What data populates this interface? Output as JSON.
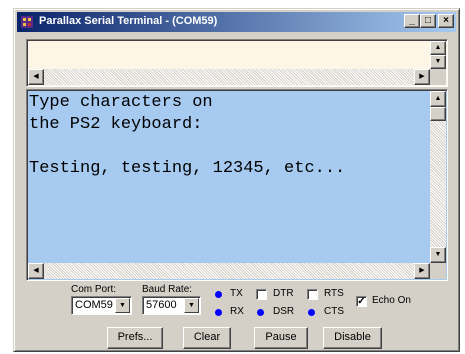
{
  "window": {
    "title": "Parallax Serial Terminal - (COM59)",
    "controls": {
      "minimize": "_",
      "maximize": "□",
      "close": "×"
    }
  },
  "transmit": {
    "text": ""
  },
  "receive": {
    "lines": [
      "Type characters on",
      "the PS2 keyboard:",
      "",
      "Testing, testing, 12345, etc..."
    ]
  },
  "settings": {
    "com_port_label": "Com Port:",
    "com_port_value": "COM59",
    "baud_rate_label": "Baud Rate:",
    "baud_rate_value": "57600"
  },
  "indicators": {
    "tx": {
      "label": "TX",
      "color": "#0000ff"
    },
    "rx": {
      "label": "RX",
      "color": "#0000ff"
    },
    "dsr": {
      "label": "DSR",
      "color": "#0000ff"
    },
    "cts": {
      "label": "CTS",
      "color": "#0000ff"
    }
  },
  "checkboxes": {
    "dtr": {
      "label": "DTR",
      "checked": false
    },
    "rts": {
      "label": "RTS",
      "checked": false
    },
    "echo": {
      "label": "Echo On",
      "checked": true,
      "mark": "✓"
    }
  },
  "buttons": {
    "prefs": "Prefs...",
    "clear": "Clear",
    "pause": "Pause",
    "disable": "Disable"
  },
  "colors": {
    "titlebar_start": "#0a246a",
    "titlebar_end": "#a6caf0",
    "receive_bg": "#a6caf0",
    "transmit_bg": "#fdf5e6"
  }
}
